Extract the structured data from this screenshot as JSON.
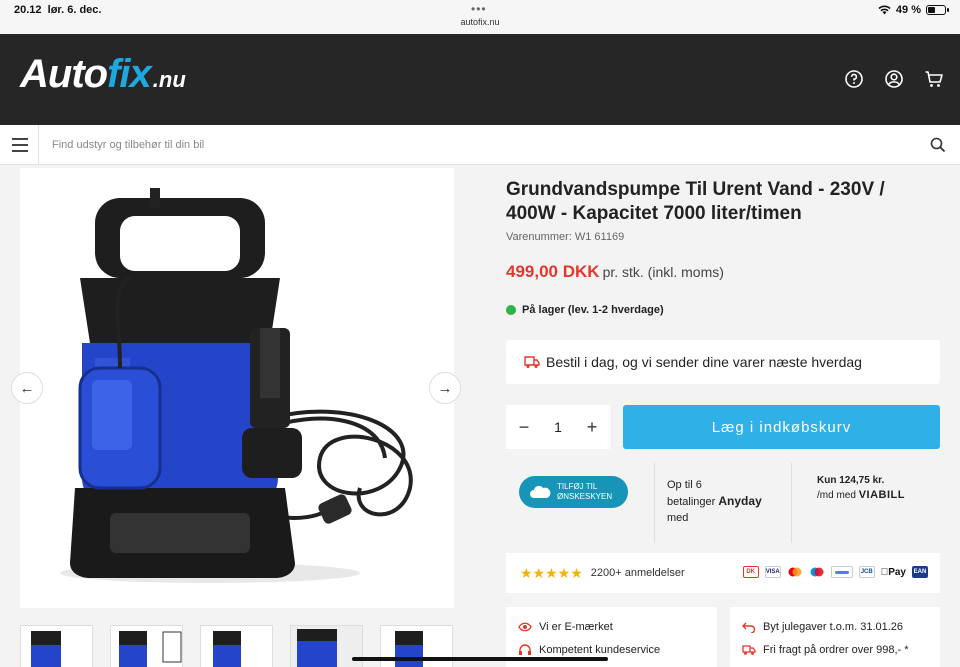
{
  "status_bar": {
    "time": "20.12",
    "date": "lør. 6. dec.",
    "url": "autofix.nu",
    "battery": "49 %",
    "battery_level": 0.49
  },
  "header": {
    "logo_part1": "Auto",
    "logo_part2": "fix",
    "logo_part3": ".nu",
    "icons": [
      "help-icon",
      "account-icon",
      "cart-icon"
    ]
  },
  "search": {
    "placeholder": "Find udstyr og tilbehør til din bil"
  },
  "product": {
    "title": "Grundvandspumpe Til Urent Vand - 230V / 400W - Kapacitet 7000 liter/timen",
    "sku": "Varenummer: W1 61169",
    "price": "499,00 DKK",
    "price_suffix": "pr. stk. (inkl. moms)",
    "stock": "På lager (lev. 1-2 hverdage)",
    "shipping": "Bestil i dag, og vi sender dine varer næste hverdag",
    "quantity": "1",
    "qty_minus": "−",
    "qty_plus": "+",
    "add_to_cart": "Læg i indkøbskurv"
  },
  "promo": {
    "wishlist_line1": "TILFØJ TIL",
    "wishlist_line2": "ØNSKESKYEN",
    "anyday_text1": "Op til 6",
    "anyday_text2": "betalinger",
    "anyday_text3": "med",
    "anyday_brand": "Anyday",
    "viabill_text1": "Kun 124,75 kr.",
    "viabill_text2": "/md med",
    "viabill_brand": "VIABILL"
  },
  "reviews": {
    "stars": "★★★★★",
    "count_text": "2200+ anmeldelser",
    "payment_icons": [
      "dankort",
      "visa",
      "mastercard",
      "maestro",
      "mobilepay",
      "jcb",
      "apple-pay",
      "ean"
    ],
    "applepay_label": "Pay",
    "ean_label": "EAN",
    "visa_label": "VISA",
    "jcb_label": "JCB"
  },
  "usps_left": [
    {
      "icon": "eye-icon",
      "text": "Vi er E-mærket"
    },
    {
      "icon": "headset-icon",
      "text": "Kompetent kundeservice"
    }
  ],
  "usps_right": [
    {
      "icon": "return-icon",
      "text": "Byt julegaver t.o.m. 31.01.26"
    },
    {
      "icon": "truck-icon",
      "text": "Fri fragt på ordrer over 998,- *"
    }
  ],
  "gallery": {
    "prev": "←",
    "next": "→",
    "thumbnails": 5
  },
  "colors": {
    "header_bg": "#262626",
    "accent_blue": "#2fb1e8",
    "price_red": "#e4372b",
    "stock_green": "#2fb344"
  }
}
